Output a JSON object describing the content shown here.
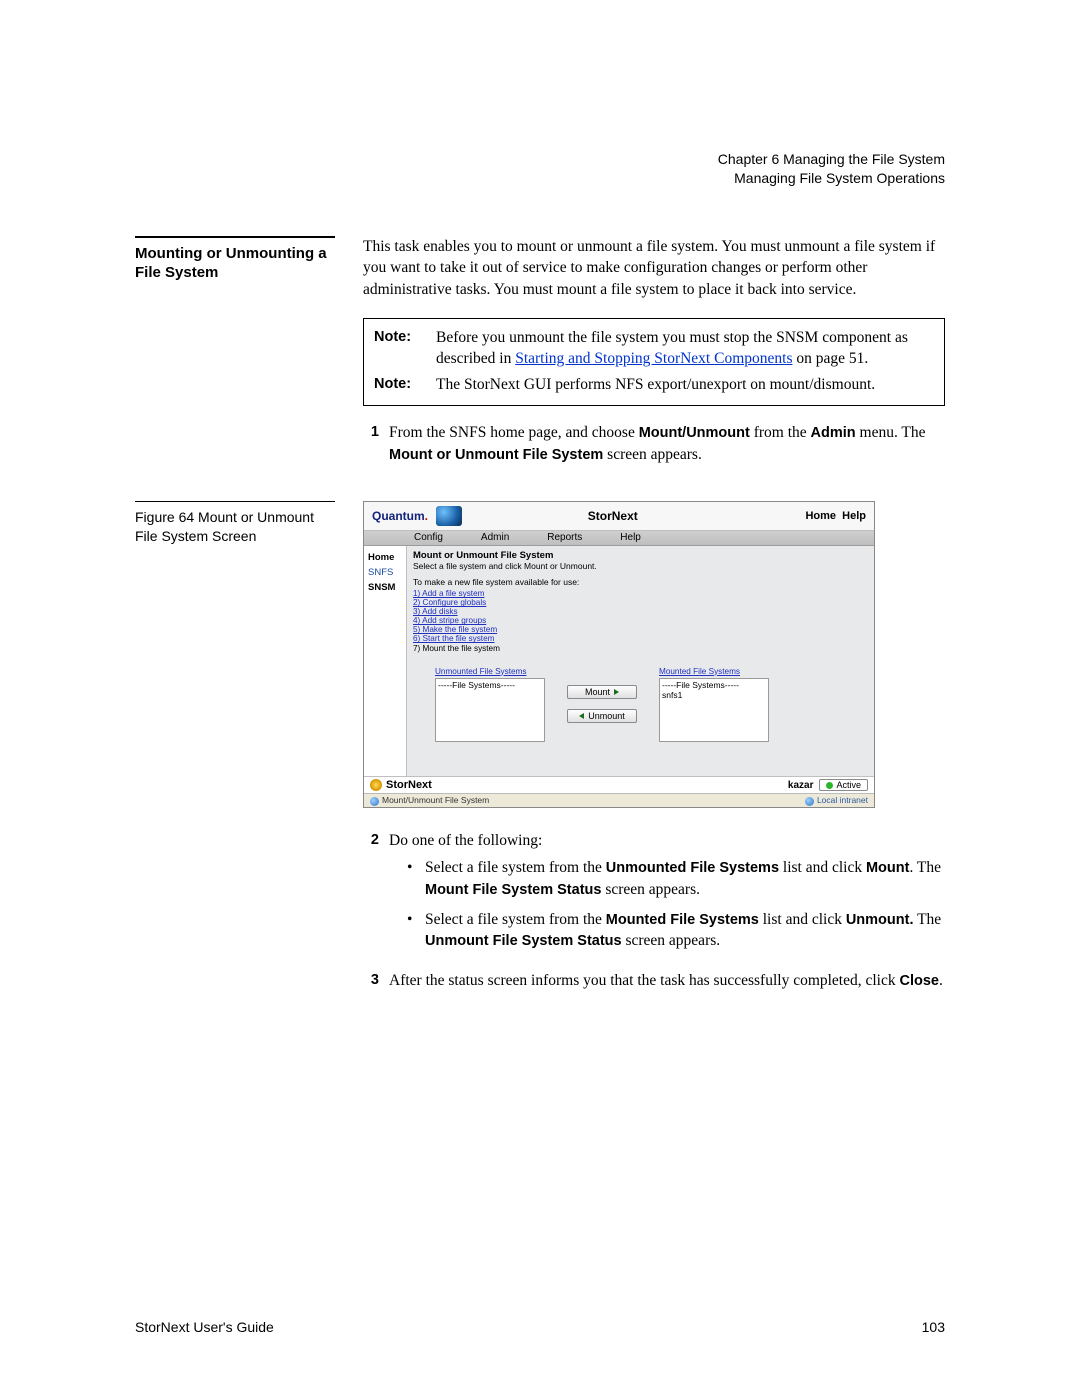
{
  "header": {
    "chapter": "Chapter 6  Managing the File System",
    "subtitle": "Managing File System Operations"
  },
  "section_title": "Mounting or Unmounting a File System",
  "intro": "This task enables you to mount or unmount a file system. You must unmount a file system if you want to take it out of service to make configuration changes or perform other administrative tasks. You must mount a file system to place it back into service.",
  "notes": {
    "label1": "Note:",
    "text1a": "Before you unmount the file system you must stop the SNSM component as described in ",
    "link1": "Starting and Stopping StorNext Components",
    "text1b": " on page   51.",
    "label2": "Note:",
    "text2": "The StorNext GUI performs NFS export/unexport on mount/dismount."
  },
  "step1": {
    "num": "1",
    "t1": "From the SNFS home page, and choose ",
    "b1": "Mount/Unmount",
    "t2": " from the ",
    "b2": "Admin",
    "t3": " menu. The ",
    "b3": "Mount or Unmount File System",
    "t4": " screen appears."
  },
  "figure_caption": "Figure 64  Mount or Unmount File System Screen",
  "screenshot": {
    "brand": "Quantum",
    "title": "StorNext",
    "home": "Home",
    "help": "Help",
    "menu": {
      "config": "Config",
      "admin": "Admin",
      "reports": "Reports",
      "helpm": "Help"
    },
    "side": {
      "home": "Home",
      "snfs": "SNFS",
      "snsm": "SNSM"
    },
    "panel_title": "Mount or Unmount File System",
    "panel_sub": "Select a file system and click Mount or Unmount.",
    "make_label": "To make a new file system available for use:",
    "steps": [
      "1) Add a file system",
      "2) Configure globals",
      "3) Add disks",
      "4) Add stripe groups",
      "5) Make the file system",
      "6) Start the file system",
      "7) Mount the file system"
    ],
    "unmounted_label": "Unmounted File Systems",
    "unmounted_placeholder": "-----File Systems-----",
    "mounted_label": "Mounted File Systems",
    "mounted_placeholder": "-----File Systems-----",
    "mounted_item": "snfs1",
    "mount_btn": "Mount",
    "unmount_btn": "Unmount",
    "footer_brand": "StorNext",
    "host": "kazar",
    "active": "Active",
    "status_left": "Mount/Unmount File System",
    "status_right": "Local intranet"
  },
  "step2": {
    "num": "2",
    "lead": "Do one of the following:",
    "b1_t1": "Select a file system from the ",
    "b1_b1": "Unmounted File Systems",
    "b1_t2": " list and click ",
    "b1_b2": "Mount",
    "b1_t3": ". The ",
    "b1_b3": "Mount File System Status",
    "b1_t4": " screen appears.",
    "b2_t1": "Select a file system from the ",
    "b2_b1": "Mounted File Systems",
    "b2_t2": " list and click ",
    "b2_b2": "Unmount.",
    "b2_t3": " The ",
    "b2_b3": "Unmount File System Status",
    "b2_t4": " screen appears."
  },
  "step3": {
    "num": "3",
    "t1": "After the status screen informs you that the task has successfully completed, click ",
    "b1": "Close",
    "t2": "."
  },
  "footer": {
    "left": "StorNext User's Guide",
    "right": "103"
  }
}
